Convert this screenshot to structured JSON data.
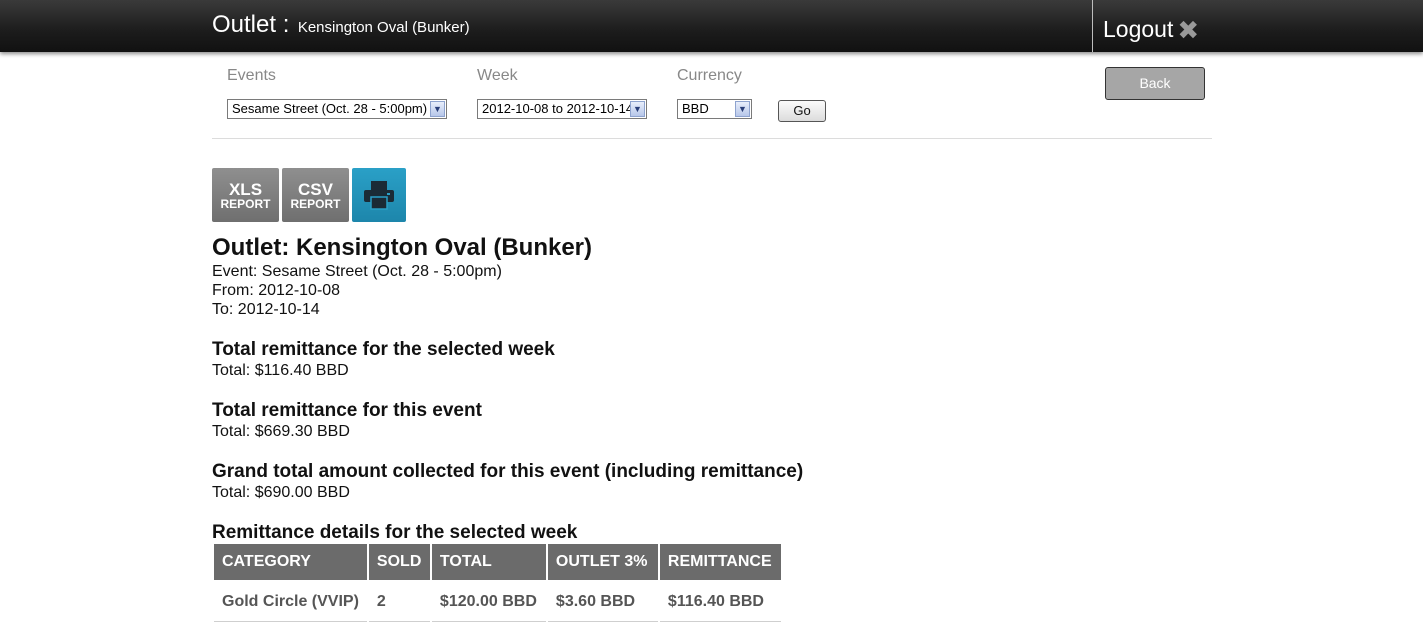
{
  "header": {
    "outlet_label": "Outlet :",
    "outlet_name": "Kensington Oval (Bunker)",
    "logout_label": "Logout",
    "logout_icon": "close-x-icon"
  },
  "filters": {
    "events_label": "Events",
    "events_value": "Sesame Street (Oct. 28 - 5:00pm)",
    "week_label": "Week",
    "week_value": "2012-10-08 to 2012-10-14",
    "currency_label": "Currency",
    "currency_value": "BBD",
    "go_label": "Go",
    "back_label": "Back"
  },
  "report_buttons": {
    "xls_big": "XLS",
    "xls_small": "REPORT",
    "csv_big": "CSV",
    "csv_small": "REPORT",
    "print_icon": "printer-icon"
  },
  "report": {
    "title": "Outlet: Kensington Oval (Bunker)",
    "event_line": "Event: Sesame Street (Oct. 28 - 5:00pm)",
    "from_line": "From: 2012-10-08",
    "to_line": "To: 2012-10-14",
    "week_heading": "Total remittance for the selected week",
    "week_total": "Total: $116.40 BBD",
    "event_heading": "Total remittance for this event",
    "event_total": "Total: $669.30 BBD",
    "grand_heading": "Grand total amount collected for this event (including remittance)",
    "grand_total": "Total: $690.00 BBD",
    "details_heading": "Remittance details for the selected week"
  },
  "table": {
    "headers": [
      "CATEGORY",
      "SOLD",
      "TOTAL",
      "OUTLET 3%",
      "REMITTANCE"
    ],
    "rows": [
      [
        "Gold Circle (VVIP)",
        "2",
        "$120.00 BBD",
        "$3.60 BBD",
        "$116.40 BBD"
      ]
    ]
  },
  "colors": {
    "header_bg": "#1c1c1c",
    "table_header_bg": "#6b6b6b",
    "print_button_bg": "#1d86ab",
    "report_button_bg": "#7a7a7a"
  }
}
